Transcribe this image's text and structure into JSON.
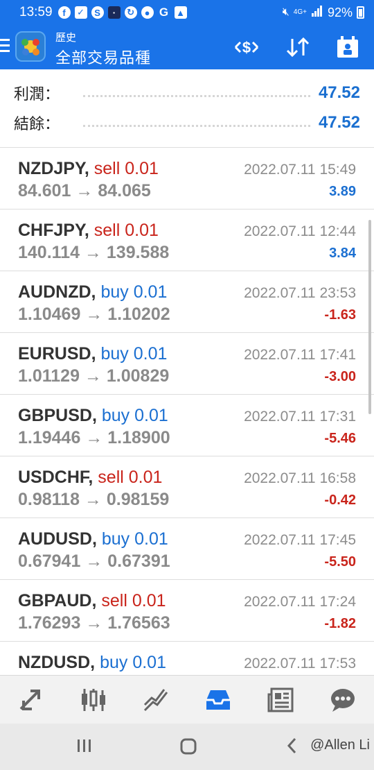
{
  "status_bar": {
    "time": "13:59",
    "battery": "92%",
    "network": "4G+",
    "left_icons": [
      "facebook-icon",
      "check-icon",
      "shazam-icon",
      "app-icon",
      "refresh-icon",
      "chat-icon",
      "google-icon",
      "image-icon"
    ]
  },
  "app_bar": {
    "subtitle": "歷史",
    "title": "全部交易品種"
  },
  "summary": {
    "profit_label": "利潤：",
    "profit_value": "47.52",
    "balance_label": "結餘：",
    "balance_value": "47.52"
  },
  "trades": [
    {
      "symbol": "NZDJPY,",
      "side": "sell 0.01",
      "side_type": "sell",
      "prices": "84.601 → 84.065",
      "time": "2022.07.11 15:49",
      "profit": "3.89",
      "profit_sign": "pos"
    },
    {
      "symbol": "CHFJPY,",
      "side": "sell 0.01",
      "side_type": "sell",
      "prices": "140.114 → 139.588",
      "time": "2022.07.11 12:44",
      "profit": "3.84",
      "profit_sign": "pos"
    },
    {
      "symbol": "AUDNZD,",
      "side": "buy 0.01",
      "side_type": "buy",
      "prices": "1.10469 → 1.10202",
      "time": "2022.07.11 23:53",
      "profit": "-1.63",
      "profit_sign": "neg"
    },
    {
      "symbol": "EURUSD,",
      "side": "buy 0.01",
      "side_type": "buy",
      "prices": "1.01129 → 1.00829",
      "time": "2022.07.11 17:41",
      "profit": "-3.00",
      "profit_sign": "neg"
    },
    {
      "symbol": "GBPUSD,",
      "side": "buy 0.01",
      "side_type": "buy",
      "prices": "1.19446 → 1.18900",
      "time": "2022.07.11 17:31",
      "profit": "-5.46",
      "profit_sign": "neg"
    },
    {
      "symbol": "USDCHF,",
      "side": "sell 0.01",
      "side_type": "sell",
      "prices": "0.98118 → 0.98159",
      "time": "2022.07.11 16:58",
      "profit": "-0.42",
      "profit_sign": "neg"
    },
    {
      "symbol": "AUDUSD,",
      "side": "buy 0.01",
      "side_type": "buy",
      "prices": "0.67941 → 0.67391",
      "time": "2022.07.11 17:45",
      "profit": "-5.50",
      "profit_sign": "neg"
    },
    {
      "symbol": "GBPAUD,",
      "side": "sell 0.01",
      "side_type": "sell",
      "prices": "1.76293 → 1.76563",
      "time": "2022.07.11 17:24",
      "profit": "-1.82",
      "profit_sign": "neg"
    },
    {
      "symbol": "NZDUSD,",
      "side": "buy 0.01",
      "side_type": "buy",
      "prices": "",
      "time": "2022.07.11 17:53",
      "profit": "",
      "profit_sign": "neg"
    }
  ],
  "bottom_nav": [
    "quotes-icon",
    "chart-icon",
    "trade-icon",
    "history-icon",
    "news-icon",
    "chat-icon"
  ],
  "bottom_nav_active": "history-icon",
  "watermark": "@Allen Li",
  "colors": {
    "accent": "#1a73e8",
    "sell": "#c9241b",
    "buy": "#1b6fd1"
  }
}
